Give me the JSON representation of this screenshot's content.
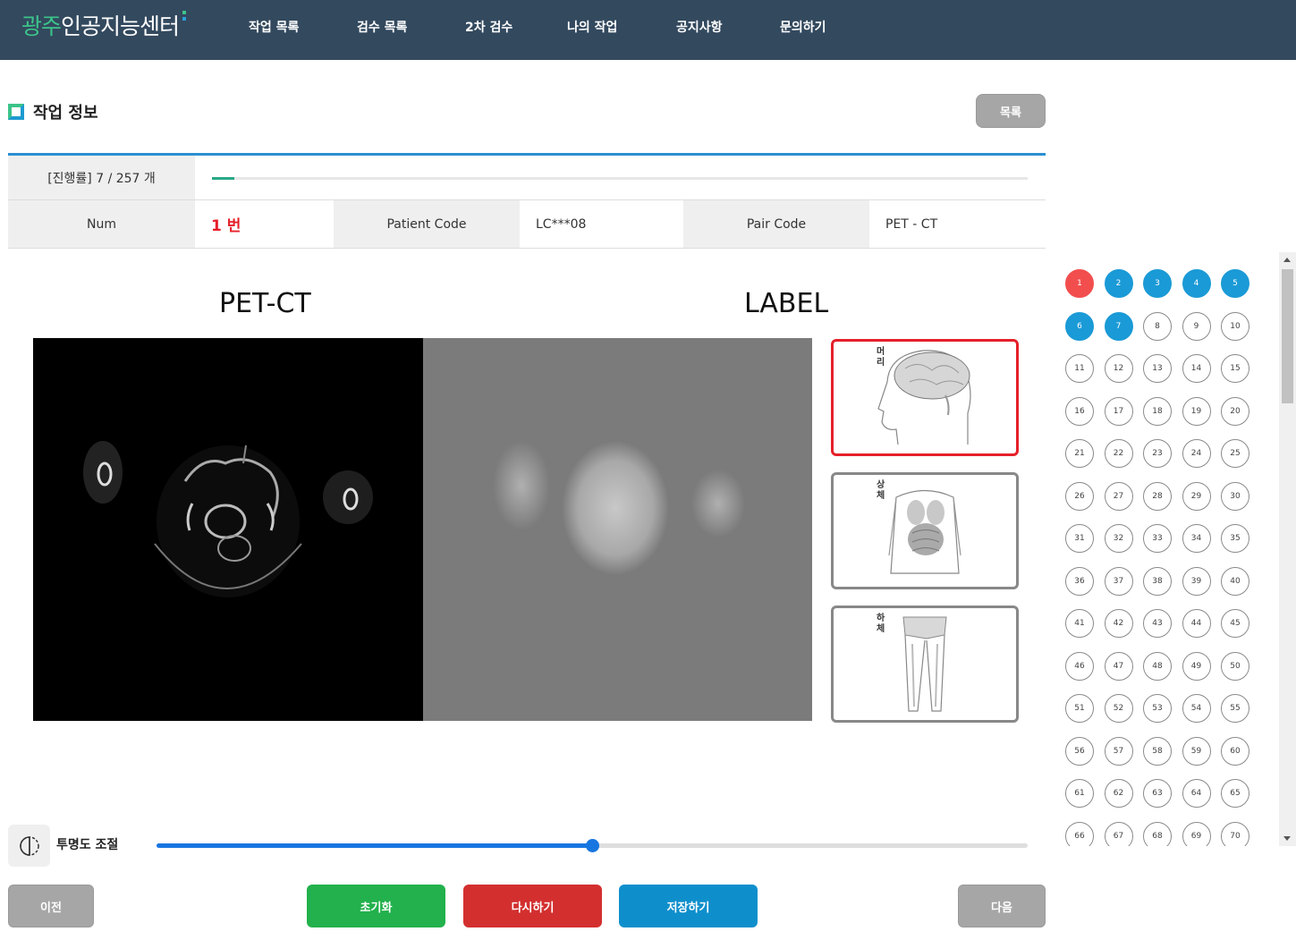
{
  "header": {
    "logo_part1": "광주",
    "logo_part2": "인공지능센터",
    "nav": [
      "작업 목록",
      "검수 목록",
      "2차 검수",
      "나의 작업",
      "공지사항",
      "문의하기"
    ]
  },
  "section": {
    "title": "작업 정보",
    "list_button": "목록"
  },
  "progress": {
    "label": "[진행률] 7 / 257 개",
    "done": 7,
    "total": 257
  },
  "info": {
    "num_label": "Num",
    "num_value": "1 번",
    "patient_label": "Patient Code",
    "patient_value": "LC***08",
    "pair_label": "Pair Code",
    "pair_value": "PET - CT"
  },
  "viewer": {
    "left_title": "PET-CT",
    "right_title": "LABEL"
  },
  "labels": [
    {
      "text": "머리",
      "icon": "head-brain-icon",
      "selected": true
    },
    {
      "text": "상체",
      "icon": "upper-body-icon",
      "selected": false
    },
    {
      "text": "하체",
      "icon": "lower-body-icon",
      "selected": false
    }
  ],
  "slices": {
    "count": 70,
    "current": 1,
    "completed": 7
  },
  "opacity": {
    "label": "투명도 조절",
    "value": 0.5,
    "icon": "opacity-icon"
  },
  "buttons": {
    "prev": "이전",
    "reset": "초기화",
    "redo": "다시하기",
    "save": "저장하기",
    "next": "다음"
  },
  "colors": {
    "header": "#33495e",
    "accent_blue": "#1a9ad6",
    "current_red": "#f24e4e",
    "reset_green": "#22b14c",
    "redo_red": "#d32f2f",
    "save_blue": "#0e8fcc"
  }
}
